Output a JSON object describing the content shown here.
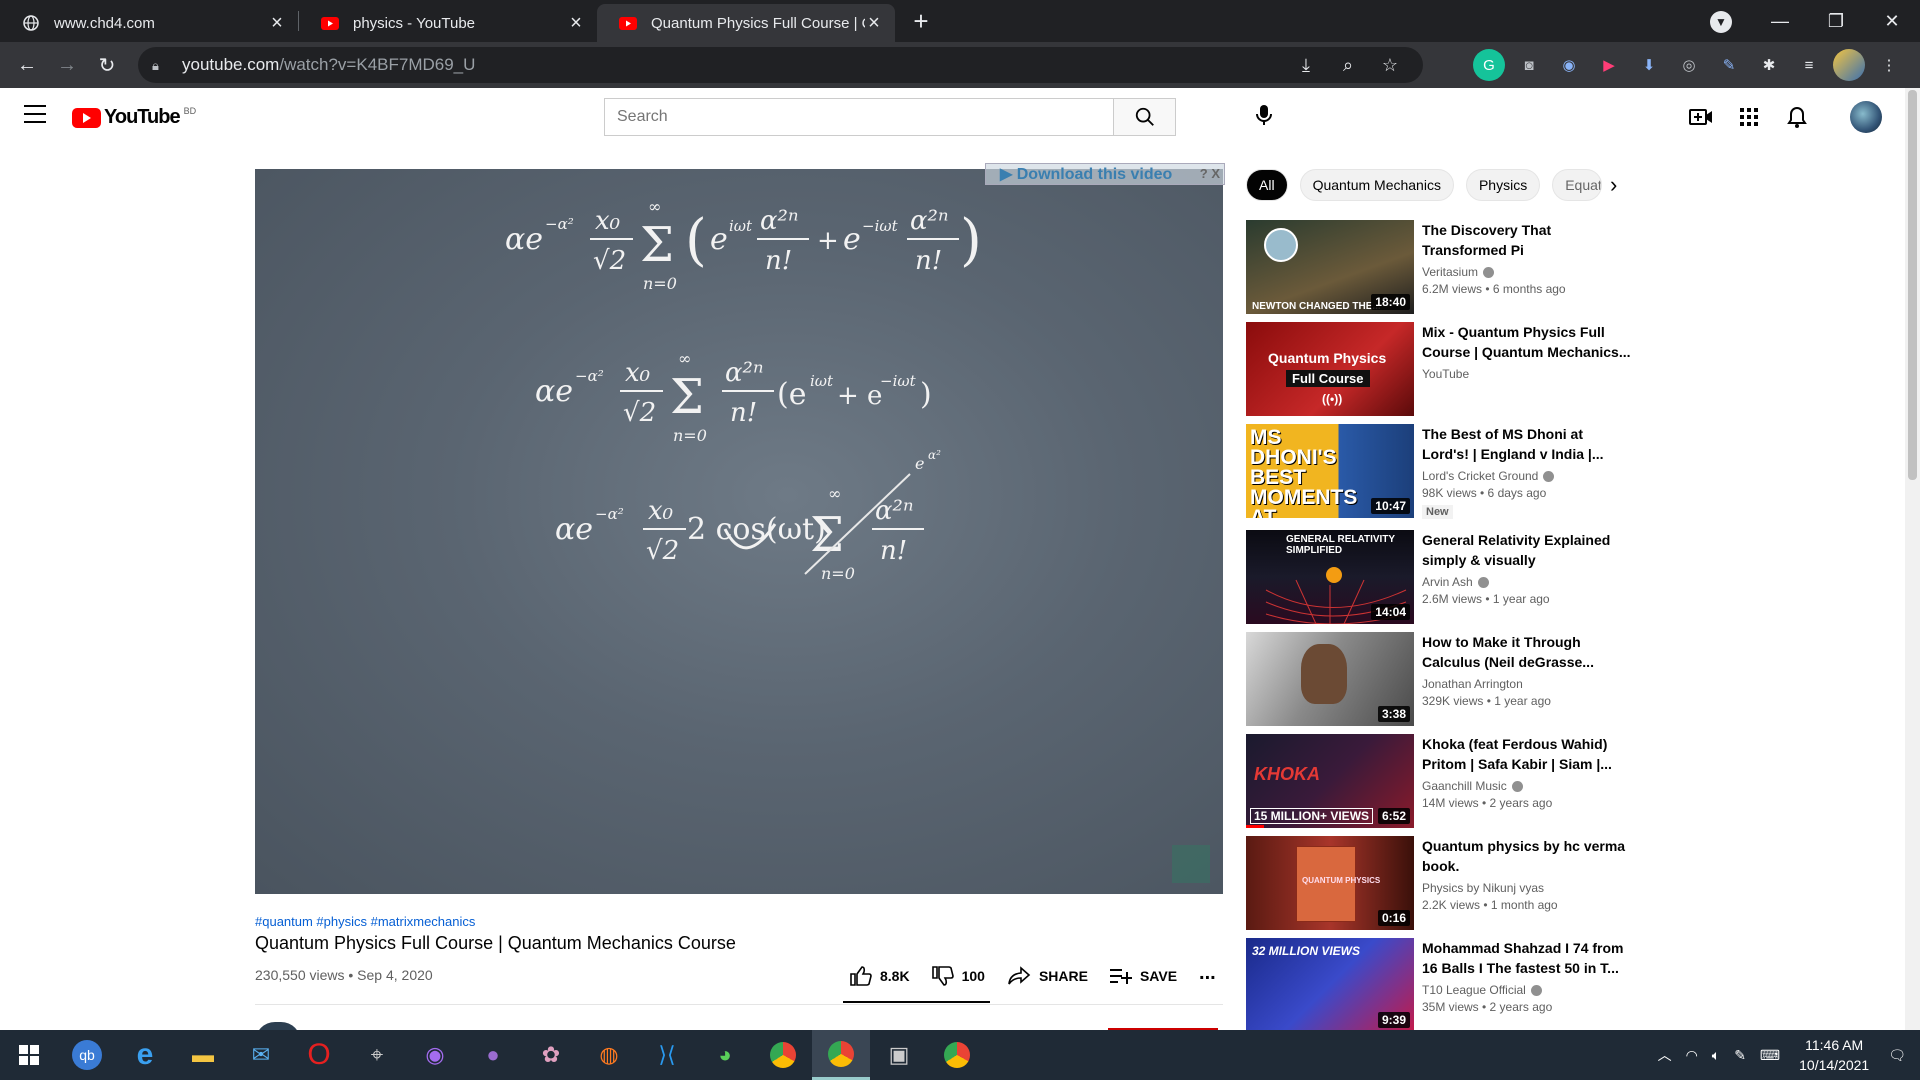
{
  "browser": {
    "tabs": [
      {
        "title": "www.chd4.com",
        "icon": "globe-icon"
      },
      {
        "title": "physics - YouTube",
        "icon": "youtube-icon"
      },
      {
        "title": "Quantum Physics Full Course | Qu",
        "icon": "youtube-icon",
        "active": true
      }
    ],
    "url_host": "youtube.com",
    "url_path": "/watch?v=K4BF7MD69_U"
  },
  "yt": {
    "country_code": "BD",
    "logo_text": "YouTube",
    "search_placeholder": "Search"
  },
  "video": {
    "overlay_download": "▶ Download this video",
    "overlay_help": "? X",
    "equations": {
      "eq1": "αe⁻ᵅ² x₀/√2 Σₙ₌₀^∞ (e^{iωt} α²ⁿ/n! + e^{−iωt} α²ⁿ/n!)",
      "eq2": "αe⁻ᵅ² x₀/√2 Σₙ₌₀^∞ α²ⁿ/n! (e^{iωt} + e^{−iωt})",
      "eq3": "αe⁻ᵅ² x₀/√2 2 cos(ωt) Σₙ₌₀^∞ α²ⁿ/n!"
    },
    "hashtags": "#quantum #physics #matrixmechanics",
    "title": "Quantum Physics Full Course | Quantum Mechanics Course",
    "views_date": "230,550 views • Sep 4, 2020",
    "likes": "8.8K",
    "dislikes": "100",
    "share_label": "SHARE",
    "save_label": "SAVE",
    "more_label": "..."
  },
  "chips": [
    "All",
    "Quantum Mechanics",
    "Physics",
    "Equat"
  ],
  "recommendations": [
    {
      "title": "The Discovery That Transformed Pi",
      "channel": "Veritasium",
      "verified": true,
      "meta": "6.2M views • 6 months ago",
      "duration": "18:40",
      "thumb_text": "NEWTON CHANGED THE..."
    },
    {
      "title": "Mix - Quantum Physics Full Course | Quantum Mechanics...",
      "channel": "YouTube",
      "verified": false,
      "meta": "",
      "duration": "",
      "thumb_text": "Quantum Physics",
      "thumb_text2": "Full Course"
    },
    {
      "title": "The Best of MS Dhoni at Lord's! | England v India |...",
      "channel": "Lord's Cricket Ground",
      "verified": true,
      "meta": "98K views • 6 days ago",
      "duration": "10:47",
      "badge": "New",
      "thumb_text": "MS DHONI'S BEST MOMENTS AT LORD'S"
    },
    {
      "title": "General Relativity Explained simply & visually",
      "channel": "Arvin Ash",
      "verified": true,
      "meta": "2.6M views • 1 year ago",
      "duration": "14:04",
      "thumb_text": "GENERAL RELATIVITY SIMPLIFIED"
    },
    {
      "title": "How to Make it Through Calculus (Neil deGrasse...",
      "channel": "Jonathan Arrington",
      "verified": false,
      "meta": "329K views • 1 year ago",
      "duration": "3:38",
      "thumb_text": ""
    },
    {
      "title": "Khoka (feat Ferdous Wahid) Pritom | Safa Kabir | Siam |...",
      "channel": "Gaanchill Music",
      "verified": true,
      "meta": "14M views • 2 years ago",
      "duration": "6:52",
      "thumb_text": "15 MILLION+ VIEWS"
    },
    {
      "title": "Quantum physics by hc verma book.",
      "channel": "Physics by Nikunj vyas",
      "verified": false,
      "meta": "2.2K views • 1 month ago",
      "duration": "0:16",
      "thumb_text": "QUANTUM PHYSICS"
    },
    {
      "title": "Mohammad Shahzad I 74 from 16 Balls I The fastest 50 in T...",
      "channel": "T10 League Official",
      "verified": true,
      "meta": "35M views • 2 years ago",
      "duration": "9:39",
      "thumb_text": "32 MILLION VIEWS"
    }
  ],
  "taskbar": {
    "time": "11:46 AM",
    "date": "10/14/2021"
  }
}
